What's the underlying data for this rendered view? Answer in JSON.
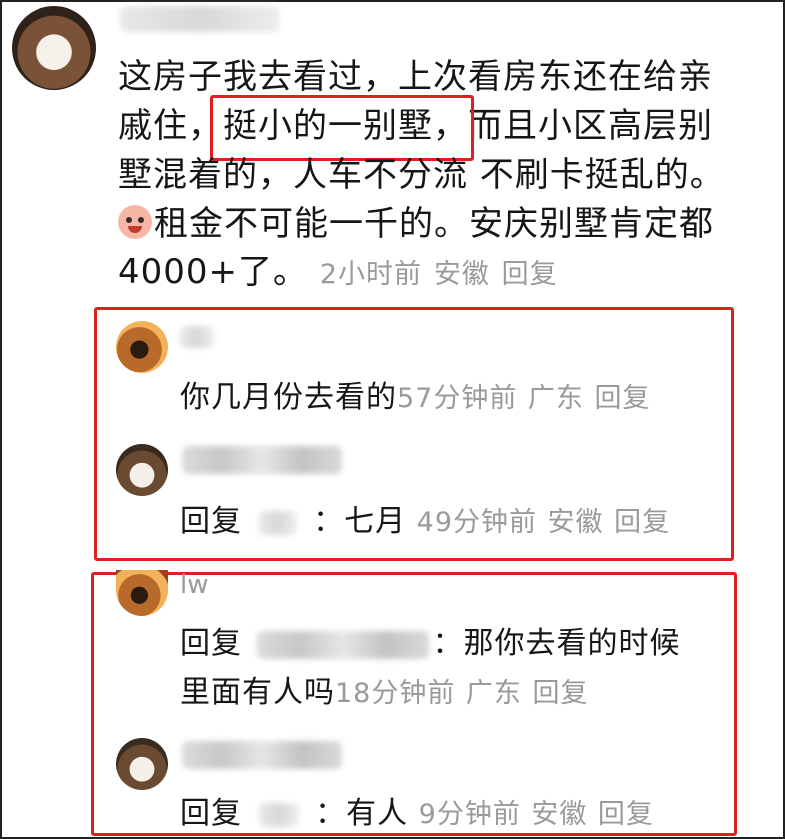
{
  "comment": {
    "lines": [
      "这房子我去看过，上次看房东还在给亲",
      "戚住，",
      "挺小的一别墅，",
      "而且小区高层别",
      "墅混着的，人车不分流 不刷卡挺乱的。",
      "租金不可能一千的。安庆别墅肯定都",
      "4000+了。"
    ],
    "time": "2小时前",
    "location": "安徽",
    "reply_label": "回复",
    "emoji_icon": "crying-laughing-emoji-icon"
  },
  "replies": [
    {
      "text": "你几月份去看的",
      "time": "57分钟前",
      "location": "广东",
      "reply_label": "回复"
    },
    {
      "prefix": "回复",
      "colon": "：",
      "text": "七月",
      "time": "49分钟前",
      "location": "安徽",
      "reply_label": "回复"
    },
    {
      "username": "lw",
      "prefix": "回复",
      "colon": "：",
      "text_line1": "那你去看的时候",
      "text_line2": "里面有人吗",
      "time": "18分钟前",
      "location": "广东",
      "reply_label": "回复"
    },
    {
      "prefix": "回复",
      "colon": "：",
      "text": "有人",
      "time": "9分钟前",
      "location": "安徽",
      "reply_label": "回复"
    }
  ],
  "colors": {
    "highlight_border": "#e02020",
    "meta_text": "#9a9a9a",
    "body_text": "#161616"
  }
}
